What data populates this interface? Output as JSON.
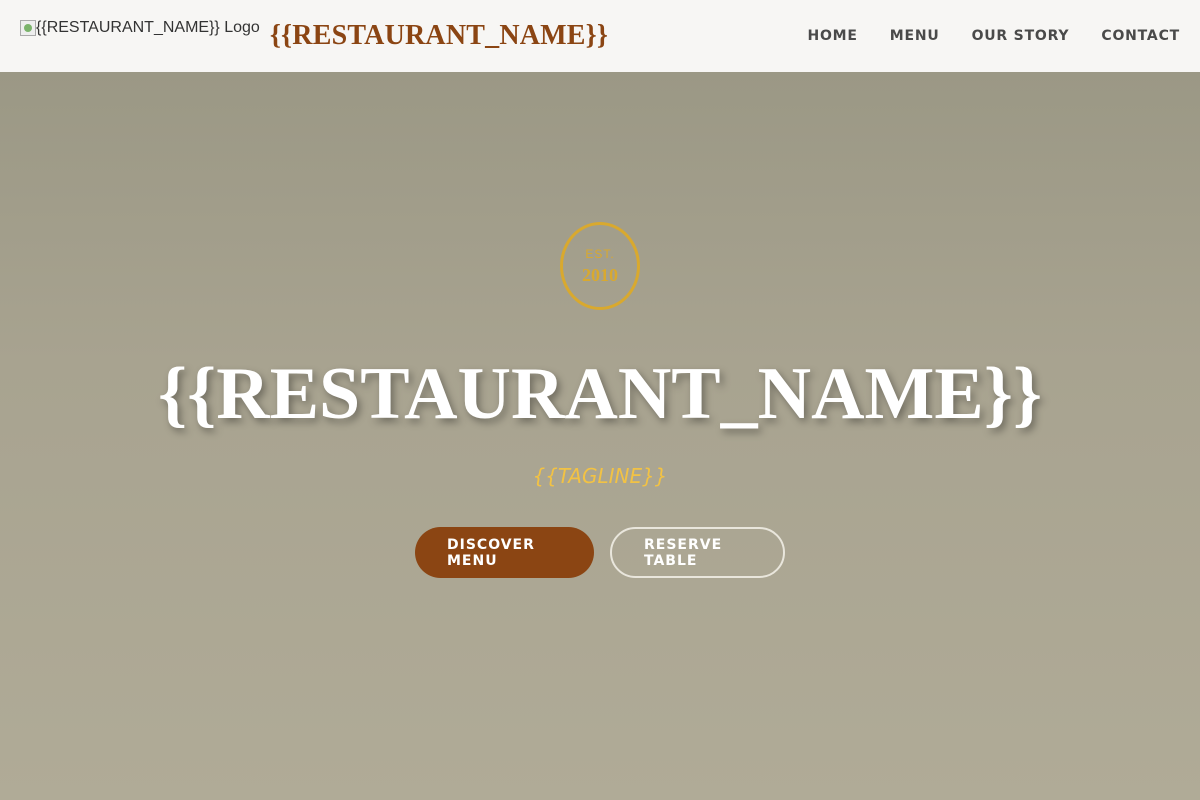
{
  "header": {
    "logo_alt": "{{RESTAURANT_NAME}} Logo",
    "brand": "{{RESTAURANT_NAME}}",
    "nav": [
      {
        "label": "HOME"
      },
      {
        "label": "MENU"
      },
      {
        "label": "OUR STORY"
      },
      {
        "label": "CONTACT"
      }
    ]
  },
  "hero": {
    "est_label": "EST.",
    "est_year": "2010",
    "title": "{{RESTAURANT_NAME}}",
    "tagline": "{{TAGLINE}}",
    "primary_button": "DISCOVER MENU",
    "secondary_button": "RESERVE TABLE"
  },
  "colors": {
    "brand": "#8b4513",
    "accent_gold": "#d9a92e",
    "hero_bg": "#a9a491",
    "nav_bg": "#f7f6f4"
  }
}
